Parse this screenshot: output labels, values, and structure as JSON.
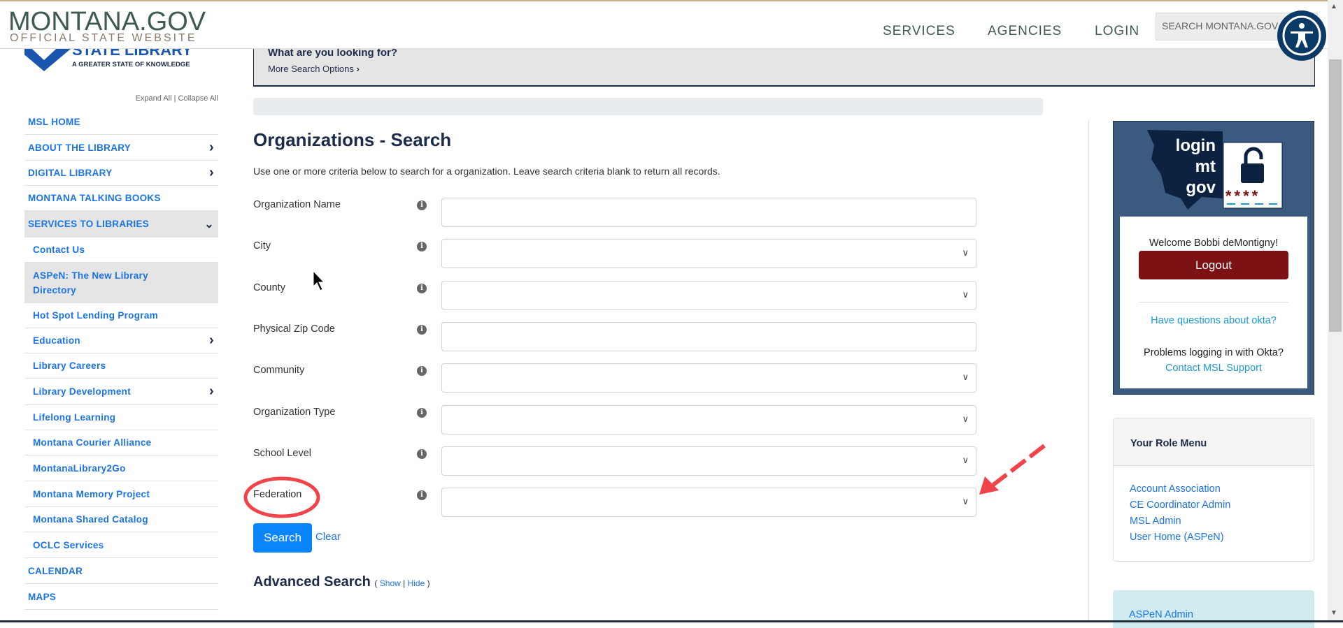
{
  "header": {
    "brand": "MONTANA.GOV",
    "tagline": "OFFICIAL STATE WEBSITE",
    "nav": [
      "SERVICES",
      "AGENCIES",
      "LOGIN"
    ],
    "search_placeholder": "SEARCH MONTANA.GOV"
  },
  "logo": {
    "name": "STATE LIBRARY",
    "tagline": "A GREATER STATE OF KNOWLEDGE"
  },
  "sidebar": {
    "expand": "Expand All | Collapse All",
    "items": [
      {
        "label": "MSL HOME"
      },
      {
        "label": "ABOUT THE LIBRARY",
        "chevron": "right"
      },
      {
        "label": "DIGITAL LIBRARY",
        "chevron": "right"
      },
      {
        "label": "MONTANA TALKING BOOKS"
      },
      {
        "label": "SERVICES TO LIBRARIES",
        "chevron": "down",
        "active": true
      },
      {
        "label": "Contact Us",
        "sub": true
      },
      {
        "label": "ASPeN: The New Library Directory",
        "sub": true,
        "active": true
      },
      {
        "label": "Hot Spot Lending Program",
        "sub": true
      },
      {
        "label": "Education",
        "sub": true,
        "chevron": "right"
      },
      {
        "label": "Library Careers",
        "sub": true
      },
      {
        "label": "Library Development",
        "sub": true,
        "chevron": "right"
      },
      {
        "label": "Lifelong Learning",
        "sub": true
      },
      {
        "label": "Montana Courier Alliance",
        "sub": true
      },
      {
        "label": "MontanaLibrary2Go",
        "sub": true
      },
      {
        "label": "Montana Memory Project",
        "sub": true
      },
      {
        "label": "Montana Shared Catalog",
        "sub": true
      },
      {
        "label": "OCLC Services",
        "sub": true
      },
      {
        "label": "CALENDAR"
      },
      {
        "label": "MAPS"
      }
    ]
  },
  "banner": {
    "question": "What are you looking for?",
    "more": "More Search Options"
  },
  "main": {
    "title": "Organizations - Search",
    "description": "Use one or more criteria below to search for a organization. Leave search criteria blank to return all records.",
    "fields": [
      {
        "label": "Organization Name",
        "type": "text",
        "value": ""
      },
      {
        "label": "City",
        "type": "select",
        "value": ""
      },
      {
        "label": "County",
        "type": "select",
        "value": ""
      },
      {
        "label": "Physical Zip Code",
        "type": "text",
        "value": ""
      },
      {
        "label": "Community",
        "type": "select",
        "value": ""
      },
      {
        "label": "Organization Type",
        "type": "select",
        "value": ""
      },
      {
        "label": "School Level",
        "type": "select",
        "value": ""
      },
      {
        "label": "Federation",
        "type": "select",
        "value": ""
      }
    ],
    "search_label": "Search",
    "clear_label": "Clear",
    "advanced": "Advanced Search",
    "show": "Show",
    "hide": "Hide"
  },
  "login_panel": {
    "logo_text": [
      "login",
      "mt",
      "gov"
    ],
    "welcome": "Welcome Bobbi deMontigny!",
    "logout": "Logout",
    "okta_q": "Have questions about okta?",
    "problems": "Problems logging in with Okta?",
    "contact": "Contact MSL Support"
  },
  "role_menu": {
    "title": "Your Role Menu",
    "links": [
      "Account Association",
      "CE Coordinator Admin",
      "MSL Admin",
      "User Home (ASPeN)"
    ]
  },
  "admin_panel": {
    "link": "ASPeN Admin"
  },
  "colors": {
    "nav_link": "#1a73e8",
    "logout": "#7c1214",
    "panel": "#3a5a80",
    "annotation": "#f0444a"
  }
}
